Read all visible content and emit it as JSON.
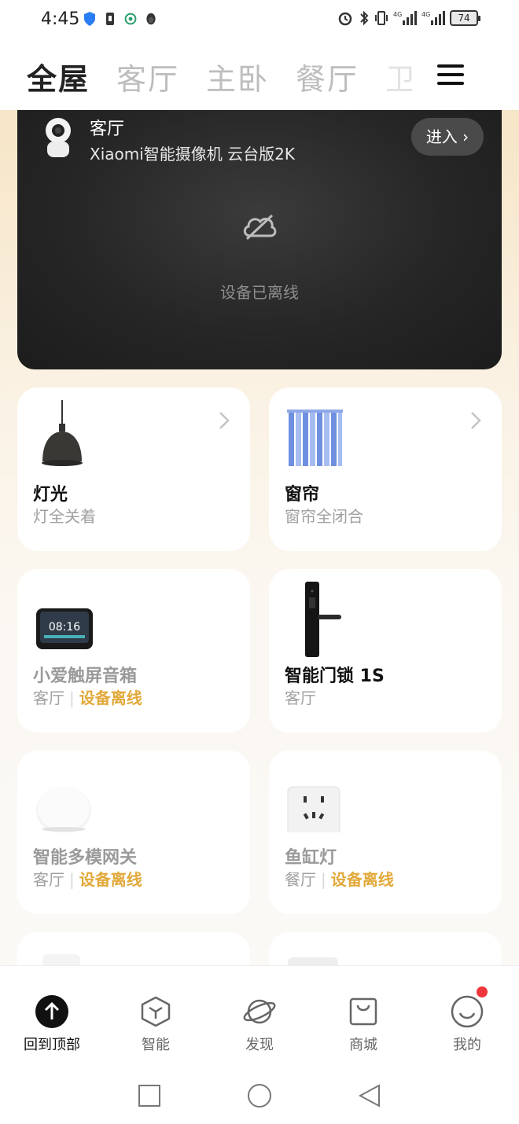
{
  "status_bar": {
    "time": "4:45",
    "battery": "74"
  },
  "header": {
    "tabs": [
      {
        "label": "全屋"
      },
      {
        "label": "客厅"
      },
      {
        "label": "主卧"
      },
      {
        "label": "餐厅"
      },
      {
        "label": "卫生"
      }
    ]
  },
  "camera": {
    "room": "客厅",
    "name": "Xiaomi智能摄像机 云台版2K",
    "enter_label": "进入",
    "offline_text": "设备已离线"
  },
  "devices": [
    {
      "title": "灯光",
      "subtitle": "灯全关着",
      "room": "",
      "status": "",
      "icon": "pendant-lamp-icon"
    },
    {
      "title": "窗帘",
      "subtitle": "窗帘全闭合",
      "room": "",
      "status": "",
      "icon": "curtain-icon"
    },
    {
      "title": "小爱触屏音箱",
      "room": "客厅",
      "status": "设备离线",
      "icon": "smart-speaker-icon",
      "screen_time": "08:16"
    },
    {
      "title": "智能门锁 1S",
      "room": "客厅",
      "status": "",
      "icon": "door-lock-icon"
    },
    {
      "title": "智能多模网关",
      "room": "客厅",
      "status": "设备离线",
      "icon": "gateway-icon"
    },
    {
      "title": "鱼缸灯",
      "room": "餐厅",
      "status": "设备离线",
      "icon": "wall-socket-icon"
    }
  ],
  "bottom_nav": [
    {
      "label": "回到顶部",
      "icon": "arrow-up-icon"
    },
    {
      "label": "智能",
      "icon": "cube-icon"
    },
    {
      "label": "发现",
      "icon": "planet-icon"
    },
    {
      "label": "商城",
      "icon": "shopping-bag-icon"
    },
    {
      "label": "我的",
      "icon": "smiley-icon"
    }
  ],
  "colors": {
    "accent_warn": "#e2a93a",
    "badge": "#f0363c"
  }
}
